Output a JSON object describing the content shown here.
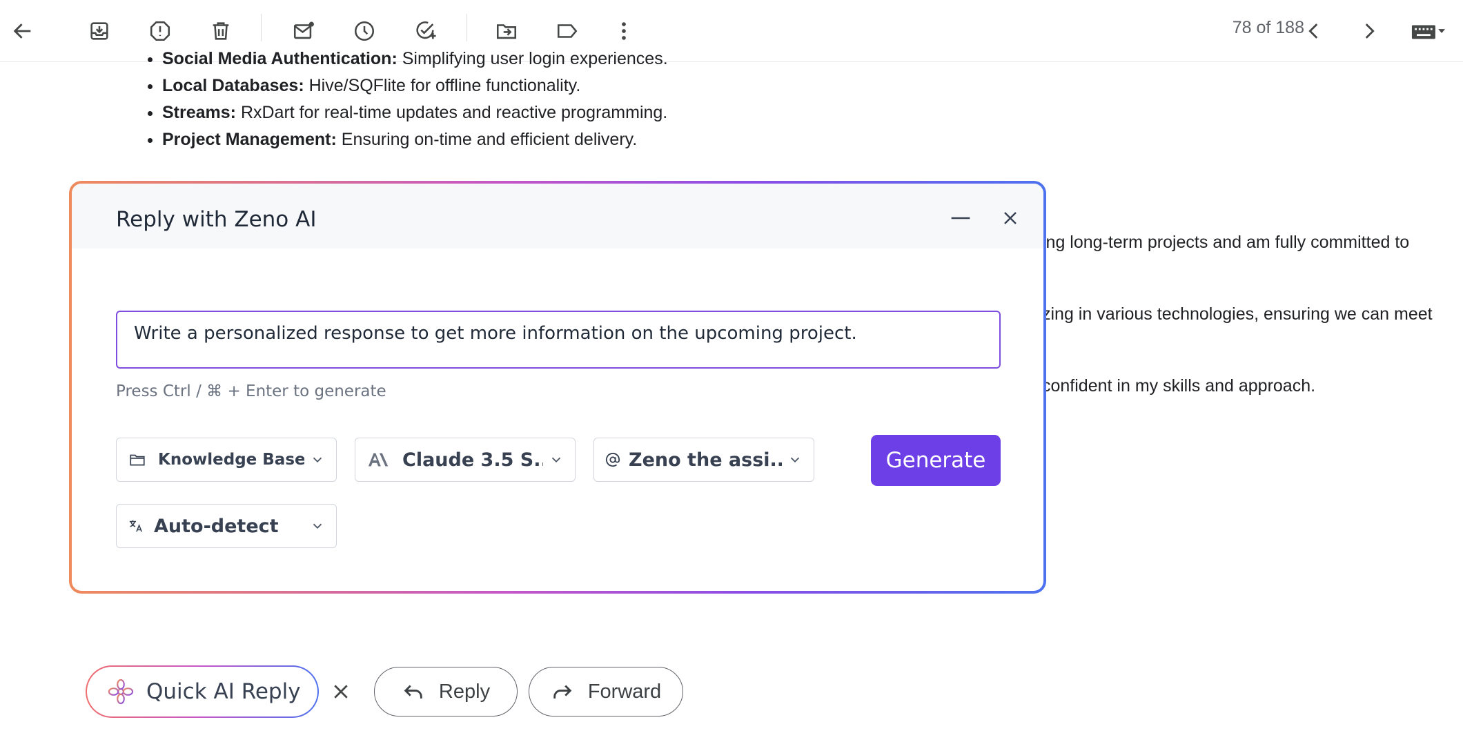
{
  "toolbar": {
    "pager_text": "78 of 188"
  },
  "email": {
    "bullets": [
      {
        "bold": "Social Media Authentication:",
        "text": " Simplifying user login experiences."
      },
      {
        "bold": "Local Databases:",
        "text": " Hive/SQFlite for offline functionality."
      },
      {
        "bold": "Streams:",
        "text": " RxDart for real-time updates and reactive programming."
      },
      {
        "bold": "Project Management:",
        "text": " Ensuring on-time and efficient delivery."
      }
    ],
    "partial_lines": [
      "ing long-term projects and am fully committed to",
      "zing in various technologies, ensuring we can meet",
      " confident in my skills and approach."
    ]
  },
  "dialog": {
    "title": "Reply with Zeno AI",
    "prompt_value": "Write a personalized response to get more information on the upcoming project.",
    "hint": "Press Ctrl / ⌘ + Enter to generate",
    "knowledge_base": "Knowledge Base",
    "model": "Claude 3.5 S...",
    "persona": "Zeno the assi...",
    "language": "Auto-detect",
    "generate_label": "Generate"
  },
  "actions": {
    "quick_reply": "Quick AI Reply",
    "reply": "Reply",
    "forward": "Forward"
  },
  "colors": {
    "accent": "#6d3fe6",
    "prompt_border": "#7c4ddf"
  }
}
